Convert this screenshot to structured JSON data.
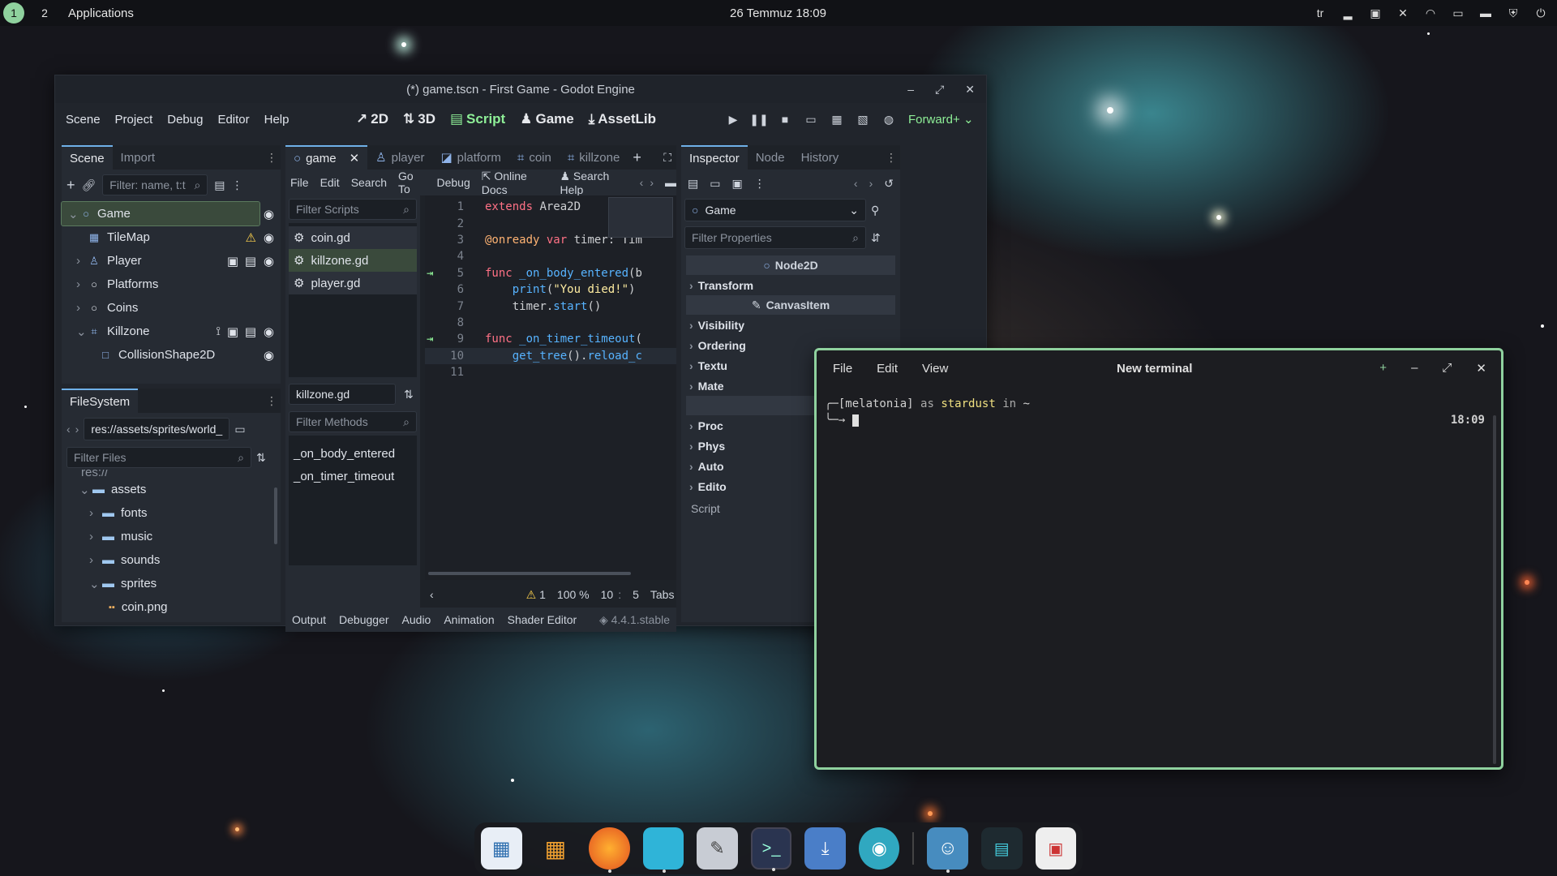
{
  "topbar": {
    "workspace_1": "1",
    "workspace_2": "2",
    "applications": "Applications",
    "clock": "26 Temmuz 18:09",
    "keyboard_layout": "tr"
  },
  "godot": {
    "title": "(*) game.tscn - First Game - Godot Engine",
    "menu": [
      "Scene",
      "Project",
      "Debug",
      "Editor",
      "Help"
    ],
    "workspaces": [
      "2D",
      "3D",
      "Script",
      "Game",
      "AssetLib"
    ],
    "renderer": "Forward+",
    "scene_tabs": {
      "scene": "Scene",
      "import": "Import"
    },
    "scene_filter_placeholder": "Filter: name, t:t",
    "scene_tree": [
      "Game",
      "TileMap",
      "Player",
      "Platforms",
      "Coins",
      "Killzone",
      "CollisionShape2D"
    ],
    "filesystem": {
      "tab": "FileSystem",
      "path": "res://assets/sprites/world_",
      "filter_placeholder": "Filter Files",
      "items": [
        "res://",
        "assets",
        "fonts",
        "music",
        "sounds",
        "sprites",
        "coin.png"
      ]
    },
    "script_tabs": [
      "game",
      "player",
      "platform",
      "coin",
      "killzone"
    ],
    "script_menu": [
      "File",
      "Edit",
      "Search",
      "Go To",
      "Debug"
    ],
    "online_docs": "Online Docs",
    "search_help": "Search Help",
    "filter_scripts_placeholder": "Filter Scripts",
    "scripts": [
      "coin.gd",
      "killzone.gd",
      "player.gd"
    ],
    "current_script": "killzone.gd",
    "filter_methods_placeholder": "Filter Methods",
    "methods": [
      "_on_body_entered",
      "_on_timer_timeout"
    ],
    "code_lines": [
      {
        "n": "1",
        "parts": [
          [
            "kw",
            "extends"
          ],
          [
            "id",
            " Area2D"
          ]
        ]
      },
      {
        "n": "2",
        "parts": []
      },
      {
        "n": "3",
        "parts": [
          [
            "ann",
            "@onready"
          ],
          [
            "kw",
            " var"
          ],
          [
            "id",
            " timer: Tim"
          ]
        ]
      },
      {
        "n": "4",
        "parts": []
      },
      {
        "n": "5",
        "parts": [
          [
            "kw",
            "func"
          ],
          [
            "fn",
            " _on_body_entered"
          ],
          [
            "id",
            "(b"
          ]
        ]
      },
      {
        "n": "6",
        "parts": [
          [
            "id",
            "    "
          ],
          [
            "fn",
            "print"
          ],
          [
            "id",
            "("
          ],
          [
            "str",
            "\"You died!\""
          ],
          [
            "id",
            ")"
          ]
        ]
      },
      {
        "n": "7",
        "parts": [
          [
            "id",
            "    timer."
          ],
          [
            "fn",
            "start"
          ],
          [
            "id",
            "()"
          ]
        ]
      },
      {
        "n": "8",
        "parts": []
      },
      {
        "n": "9",
        "parts": [
          [
            "kw",
            "func"
          ],
          [
            "fn",
            " _on_timer_timeout"
          ],
          [
            "id",
            "("
          ]
        ]
      },
      {
        "n": "10",
        "parts": [
          [
            "id",
            "    "
          ],
          [
            "fn",
            "get_tree"
          ],
          [
            "id",
            "()."
          ],
          [
            "fn",
            "reload_c"
          ]
        ]
      },
      {
        "n": "11",
        "parts": []
      }
    ],
    "status": {
      "warnings": "1",
      "zoom": "100 %",
      "line": "10",
      "col": "5",
      "indent": "Tabs"
    },
    "bottom_tabs": [
      "Output",
      "Debugger",
      "Audio",
      "Animation",
      "Shader Editor"
    ],
    "version": "4.4.1.stable",
    "inspector": {
      "tabs": [
        "Inspector",
        "Node",
        "History"
      ],
      "object": "Game",
      "filter_placeholder": "Filter Properties",
      "class_node2d": "Node2D",
      "class_canvasitem": "CanvasItem",
      "sections": [
        "Transform",
        "Visibility",
        "Ordering",
        "Textu",
        "Mate",
        "Proc",
        "Phys",
        "Auto",
        "Edito"
      ],
      "script_label": "Script"
    }
  },
  "terminal": {
    "menu": [
      "File",
      "Edit",
      "View"
    ],
    "title": "New terminal",
    "prompt_user": "[melatonia]",
    "prompt_as": "as",
    "prompt_host": "stardust",
    "prompt_in": "in",
    "prompt_dir": "~",
    "time": "18:09"
  },
  "dock": {
    "apps": [
      "files-manager-icon",
      "app-grid-icon",
      "firefox-icon",
      "folder-icon",
      "text-editor-icon",
      "terminal-icon",
      "software-store-icon",
      "settings-icon",
      "godot-icon",
      "system-monitor-icon",
      "screenshot-icon"
    ]
  },
  "colors": {
    "accent": "#8fd19e",
    "godot_blue": "#6fb0e8",
    "script_green": "#8eef97"
  }
}
